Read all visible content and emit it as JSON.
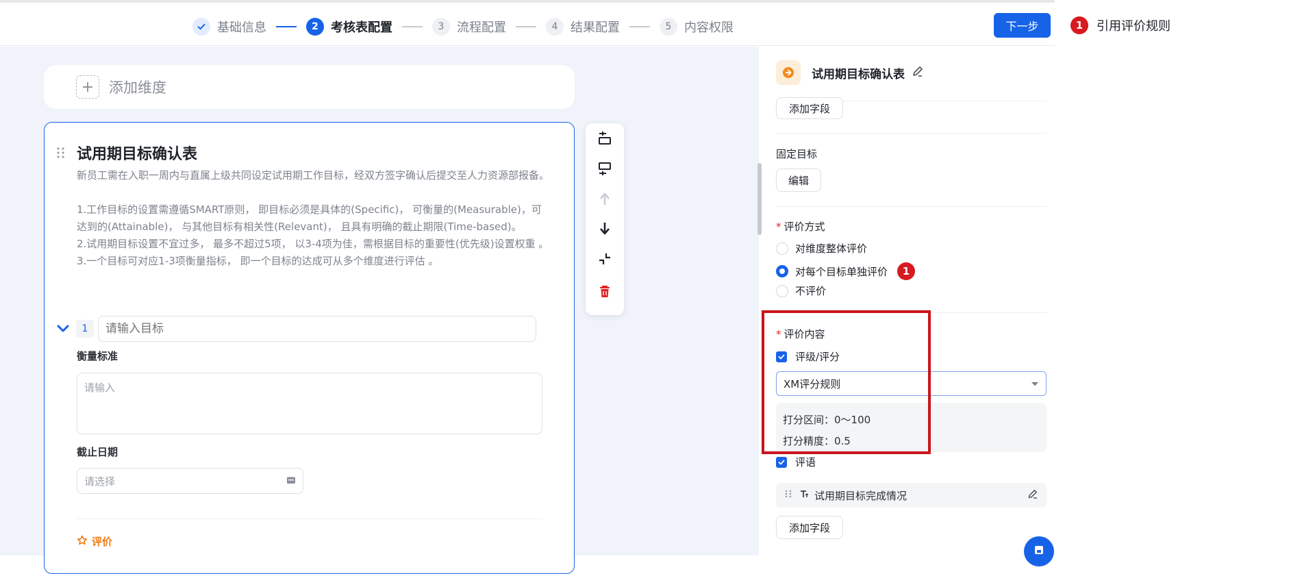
{
  "header": {
    "steps": [
      {
        "num": "",
        "label": "基础信息",
        "state": "done"
      },
      {
        "num": "2",
        "label": "考核表配置",
        "state": "active"
      },
      {
        "num": "3",
        "label": "流程配置",
        "state": "todo"
      },
      {
        "num": "4",
        "label": "结果配置",
        "state": "todo"
      },
      {
        "num": "5",
        "label": "内容权限",
        "state": "todo"
      }
    ],
    "next_label": "下一步"
  },
  "left": {
    "add_dimension_label": "添加维度",
    "card": {
      "title": "试用期目标确认表",
      "description": "新员工需在入职一周内与直属上级共同设定试用期工作目标，经双方签字确认后提交至人力资源部报备。\n\n1.工作目标的设置需遵循SMART原则， 即目标必须是具体的(Specific)， 可衡量的(Measurable)，可达到的(Attainable)， 与其他目标有相关性(Relevant)， 且具有明确的截止期限(Time-based)。\n2.试用期目标设置不宜过多， 最多不超过5项， 以3-4项为佳，需根据目标的重要性(优先级)设置权重 。\n3.一个目标可对应1-3项衡量指标， 即一个目标的达成可从多个维度进行评估 。",
      "goal_index": "1",
      "goal_placeholder": "请输入目标",
      "measure_label": "衡量标准",
      "measure_placeholder": "请输入",
      "deadline_label": "截止日期",
      "deadline_placeholder": "请选择",
      "eval_label": "评价"
    }
  },
  "right": {
    "title": "试用期目标确认表",
    "add_field_top": "添加字段",
    "fixed_goal_label": "固定目标",
    "edit_label": "编辑",
    "eval_method_label": "评价方式",
    "eval_methods": [
      "对维度整体评价",
      "对每个目标单独评价",
      "不评价"
    ],
    "eval_method_selected": 1,
    "eval_content_label": "评价内容",
    "rating_label": "评级/评分",
    "rule_selected": "XM评分规则",
    "score_range": "打分区间：0～100",
    "score_precision": "打分精度：0.5",
    "comment_label": "评语",
    "comment_field": "试用期目标完成情况",
    "add_field_bottom": "添加字段"
  },
  "annotation": {
    "badge": "1",
    "text": "引用评价规则"
  },
  "colors": {
    "primary": "#1763e8",
    "annotation_red": "#c8161d",
    "eval_orange": "#f07a13",
    "danger": "#e02424"
  }
}
